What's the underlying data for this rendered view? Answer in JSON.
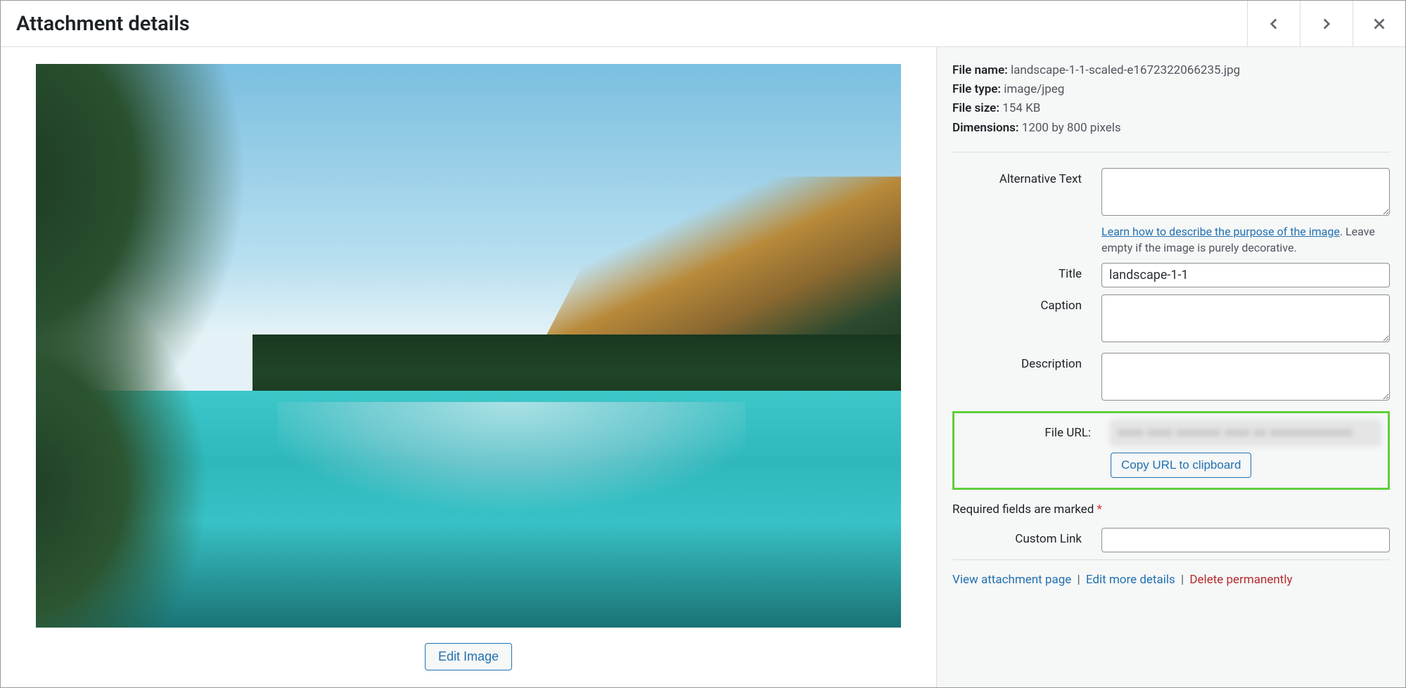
{
  "header": {
    "title": "Attachment details"
  },
  "meta": {
    "file_name_label": "File name:",
    "file_name": "landscape-1-1-scaled-e1672322066235.jpg",
    "file_type_label": "File type:",
    "file_type": "image/jpeg",
    "file_size_label": "File size:",
    "file_size": "154 KB",
    "dimensions_label": "Dimensions:",
    "dimensions": "1200 by 800 pixels"
  },
  "fields": {
    "alt_label": "Alternative Text",
    "alt_value": "",
    "alt_help_link": "Learn how to describe the purpose of the image",
    "alt_help_suffix": ". Leave empty if the image is purely decorative.",
    "title_label": "Title",
    "title_value": "landscape-1-1",
    "caption_label": "Caption",
    "caption_value": "",
    "description_label": "Description",
    "description_value": "",
    "file_url_label": "File URL:",
    "copy_btn": "Copy URL to clipboard",
    "custom_link_label": "Custom Link",
    "custom_link_value": ""
  },
  "required_note": "Required fields are marked ",
  "required_asterisk": "*",
  "edit_image_btn": "Edit Image",
  "actions": {
    "view": "View attachment page",
    "edit": "Edit more details",
    "delete": "Delete permanently"
  }
}
